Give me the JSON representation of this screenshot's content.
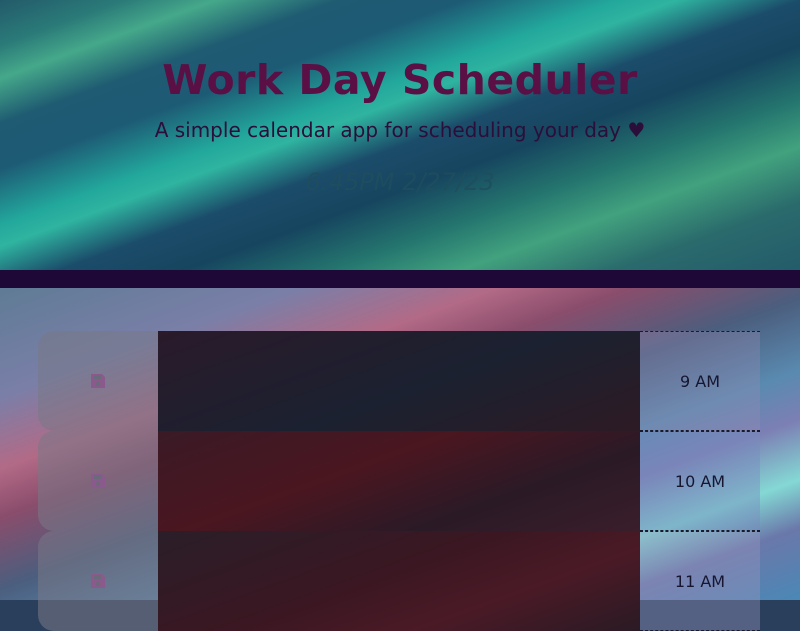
{
  "header": {
    "title": "Work Day Scheduler",
    "subtitle": "A simple calendar app for scheduling your day ♥",
    "current_time": "6:45PM 2/27/23"
  },
  "schedule": {
    "rows": [
      {
        "hour_label": "9 AM",
        "task_text": "",
        "save_icon": "floppy-disk-icon"
      },
      {
        "hour_label": "10 AM",
        "task_text": "",
        "save_icon": "floppy-disk-icon"
      },
      {
        "hour_label": "11 AM",
        "task_text": "",
        "save_icon": "floppy-disk-icon"
      }
    ]
  },
  "colors": {
    "title": "#5a1044",
    "divider": "#1e0838",
    "save_icon": "#8a5a8c"
  }
}
